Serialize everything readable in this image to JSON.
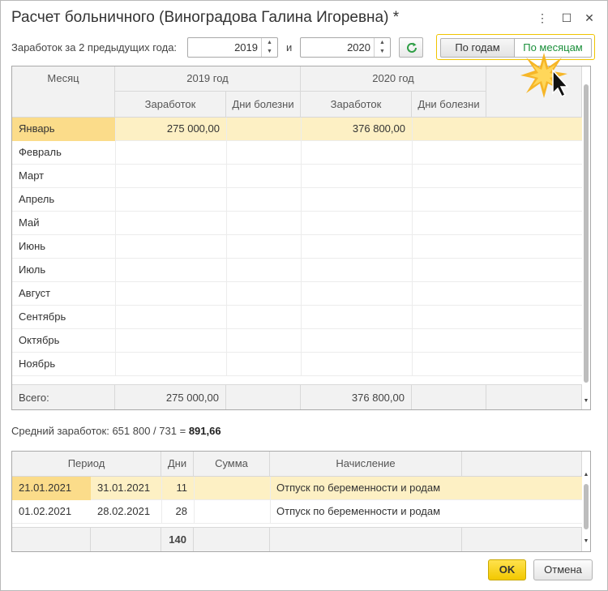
{
  "window": {
    "title": "Расчет больничного (Виноградова Галина Игоревна) *",
    "menu_icon": "⋮",
    "maximize_icon": "☐",
    "close_icon": "✕"
  },
  "period": {
    "label": "Заработок за 2 предыдущих года:",
    "year1": "2019",
    "and_label": "и",
    "year2": "2020"
  },
  "view_toggle": {
    "by_years": "По годам",
    "by_months": "По месяцам",
    "active": "by_months",
    "active_color": "#1a8f3a"
  },
  "earnings_table": {
    "col_month": "Месяц",
    "year1_header": "2019 год",
    "year2_header": "2020 год",
    "col_earnings": "Заработок",
    "col_sick_days": "Дни болезни",
    "rows": [
      {
        "month": "Январь",
        "earn1": "275 000,00",
        "days1": "",
        "earn2": "376 800,00",
        "days2": ""
      },
      {
        "month": "Февраль",
        "earn1": "",
        "days1": "",
        "earn2": "",
        "days2": ""
      },
      {
        "month": "Март",
        "earn1": "",
        "days1": "",
        "earn2": "",
        "days2": ""
      },
      {
        "month": "Апрель",
        "earn1": "",
        "days1": "",
        "earn2": "",
        "days2": ""
      },
      {
        "month": "Май",
        "earn1": "",
        "days1": "",
        "earn2": "",
        "days2": ""
      },
      {
        "month": "Июнь",
        "earn1": "",
        "days1": "",
        "earn2": "",
        "days2": ""
      },
      {
        "month": "Июль",
        "earn1": "",
        "days1": "",
        "earn2": "",
        "days2": ""
      },
      {
        "month": "Август",
        "earn1": "",
        "days1": "",
        "earn2": "",
        "days2": ""
      },
      {
        "month": "Сентябрь",
        "earn1": "",
        "days1": "",
        "earn2": "",
        "days2": ""
      },
      {
        "month": "Октябрь",
        "earn1": "",
        "days1": "",
        "earn2": "",
        "days2": ""
      },
      {
        "month": "Ноябрь",
        "earn1": "",
        "days1": "",
        "earn2": "",
        "days2": ""
      }
    ],
    "total_label": "Всего:",
    "total_earn1": "275 000,00",
    "total_earn2": "376 800,00"
  },
  "average": {
    "prefix": "Средний заработок: 651 800 / 731 =",
    "value": "891,66"
  },
  "periods_table": {
    "col_period": "Период",
    "col_days": "Дни",
    "col_sum": "Сумма",
    "col_accrual": "Начисление",
    "rows": [
      {
        "from": "21.01.2021",
        "to": "31.01.2021",
        "days": "11",
        "sum": "",
        "accrual": "Отпуск по беременности и родам"
      },
      {
        "from": "01.02.2021",
        "to": "28.02.2021",
        "days": "28",
        "sum": "",
        "accrual": "Отпуск по беременности и родам"
      }
    ],
    "total_days": "140"
  },
  "buttons": {
    "ok": "OK",
    "cancel": "Отмена"
  },
  "colors": {
    "selected_row": "#fdf0c4",
    "selected_cell": "#fbdc8a",
    "ok_button": "#f5cf10",
    "toggle_border": "#f0c400"
  }
}
